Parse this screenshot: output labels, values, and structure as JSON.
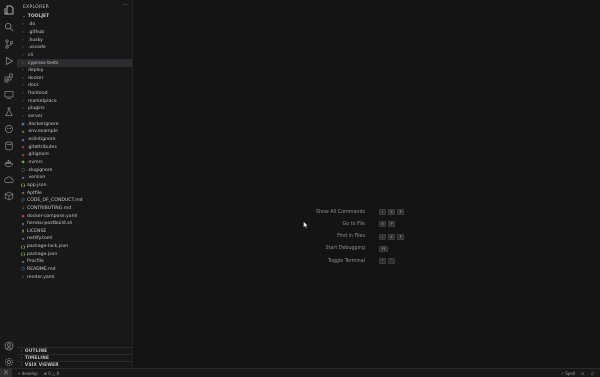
{
  "sidebar": {
    "title": "EXPLORER",
    "more": "···",
    "root": "TOOLJET",
    "items": [
      {
        "label": ".do",
        "kind": "folder"
      },
      {
        "label": ".github",
        "kind": "folder"
      },
      {
        "label": ".husky",
        "kind": "folder"
      },
      {
        "label": ".vscode",
        "kind": "folder"
      },
      {
        "label": "cli",
        "kind": "folder"
      },
      {
        "label": "cypress-tests",
        "kind": "folder",
        "selected": true
      },
      {
        "label": "deploy",
        "kind": "folder"
      },
      {
        "label": "docker",
        "kind": "folder"
      },
      {
        "label": "docs",
        "kind": "folder"
      },
      {
        "label": "frontend",
        "kind": "folder"
      },
      {
        "label": "marketplace",
        "kind": "folder"
      },
      {
        "label": "plugins",
        "kind": "folder"
      },
      {
        "label": "server",
        "kind": "folder"
      },
      {
        "label": ".dockerignore",
        "kind": "file",
        "icon": "docker-icon",
        "color": "#4a8fd6"
      },
      {
        "label": ".env.example",
        "kind": "file",
        "icon": "gear-icon",
        "color": "#c9b54a"
      },
      {
        "label": ".eslintignore",
        "kind": "file",
        "icon": "eslint-icon",
        "color": "#7b6ee0"
      },
      {
        "label": ".gitattributes",
        "kind": "file",
        "icon": "git-icon",
        "color": "#e0573a"
      },
      {
        "label": ".gitignore",
        "kind": "file",
        "icon": "git-icon",
        "color": "#e0573a"
      },
      {
        "label": ".nvmrc",
        "kind": "file",
        "icon": "node-icon",
        "color": "#6da64a"
      },
      {
        "label": ".slugignore",
        "kind": "file",
        "icon": "circle-icon",
        "color": "#8a8a8a"
      },
      {
        "label": ".version",
        "kind": "file",
        "icon": "lines-icon",
        "color": "#9a9a9a"
      },
      {
        "label": "app.json",
        "kind": "file",
        "icon": "braces-icon",
        "color": "#d4b44a"
      },
      {
        "label": "Aptfile",
        "kind": "file",
        "icon": "lines-icon",
        "color": "#9a9a9a"
      },
      {
        "label": "CODE_OF_CONDUCT.md",
        "kind": "file",
        "icon": "info-icon",
        "color": "#4a8fd6"
      },
      {
        "label": "CONTRIBUTING.md",
        "kind": "file",
        "icon": "md-icon",
        "color": "#d0603a"
      },
      {
        "label": "docker-compose.yaml",
        "kind": "file",
        "icon": "docker-icon",
        "color": "#d04a4a"
      },
      {
        "label": "heroku-postbuild.sh",
        "kind": "file",
        "icon": "shell-icon",
        "color": "#8a8a8a"
      },
      {
        "label": "LICENSE",
        "kind": "file",
        "icon": "license-icon",
        "color": "#d4b44a"
      },
      {
        "label": "netlify.toml",
        "kind": "file",
        "icon": "gear-icon",
        "color": "#9a9a9a"
      },
      {
        "label": "package-lock.json",
        "kind": "file",
        "icon": "braces-icon",
        "color": "#8fbf4a"
      },
      {
        "label": "package.json",
        "kind": "file",
        "icon": "braces-icon",
        "color": "#8fbf4a"
      },
      {
        "label": "Procfile",
        "kind": "file",
        "icon": "lines-icon",
        "color": "#9a9a9a"
      },
      {
        "label": "README.md",
        "kind": "file",
        "icon": "info-icon",
        "color": "#4a8fd6"
      },
      {
        "label": "render.yaml",
        "kind": "file",
        "icon": "exclaim-icon",
        "color": "#c05ac0"
      }
    ],
    "panels": [
      "OUTLINE",
      "TIMELINE",
      "VSIX VIEWER"
    ]
  },
  "editor": {
    "commands": [
      {
        "label": "Show All Commands",
        "keys": [
          "⇧",
          "⌘",
          "P"
        ]
      },
      {
        "label": "Go to File",
        "keys": [
          "⌘",
          "P"
        ]
      },
      {
        "label": "Find in Files",
        "keys": [
          "⇧",
          "⌘",
          "F"
        ]
      },
      {
        "label": "Start Debugging",
        "keys": [
          "F5"
        ]
      },
      {
        "label": "Toggle Terminal",
        "keys": [
          "⌃",
          "`"
        ]
      }
    ]
  },
  "status": {
    "branch": "develop",
    "errors": "0",
    "warnings": "0",
    "spell": "Spell",
    "remote_icon": "remote-icon"
  }
}
